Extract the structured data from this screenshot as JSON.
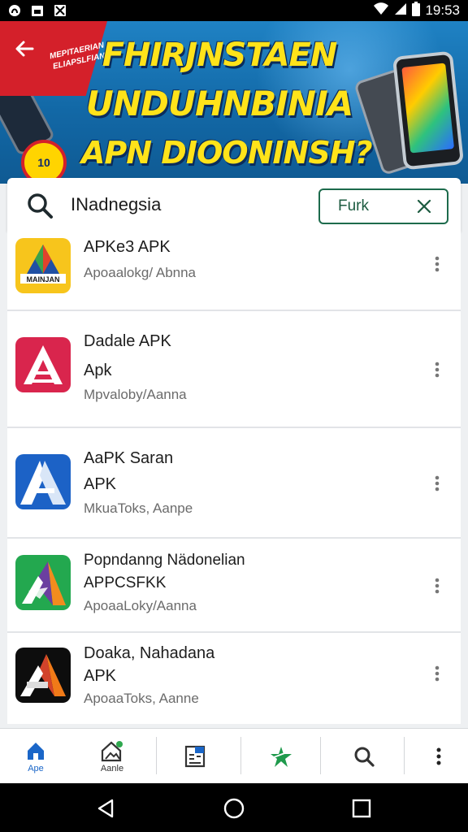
{
  "status_bar": {
    "time": "19:53",
    "left_icons": [
      "app-notification-icon",
      "calendar-icon",
      "gallery-icon"
    ],
    "right_icons": [
      "wifi-icon",
      "cellular-signal-icon",
      "battery-icon"
    ]
  },
  "banner": {
    "headline_line1": "FHIRJNSTAEN",
    "headline_line2": "UNDUHNBINIA",
    "headline_line3": "APN DIOONINSH?",
    "promo_text": "MEPITAERIAN ELIAPSLFIAN",
    "badge_text": "10",
    "back_icon": "arrow-back-icon"
  },
  "search": {
    "query": "INadnegsia",
    "filter_chip_label": "Furk",
    "chip_close_icon": "close-icon"
  },
  "apps": [
    {
      "title": "APKe3 APK",
      "subtitle": "",
      "meta": "Apoaalokg/ Abnna",
      "icon_label": "MAINJAN",
      "icon_style": "yellow"
    },
    {
      "title": "Dadale APK",
      "subtitle": "Apk",
      "meta": "Mpvaloby/Aanna",
      "icon_style": "red"
    },
    {
      "title": "AaPK Saran",
      "subtitle": "APK",
      "meta": "MkuaToks, Aanpe",
      "icon_style": "blue"
    },
    {
      "title": "Popndanng Nädonelian",
      "subtitle": "APPCSFKK",
      "meta": "ApoaaLoky/Aanna",
      "icon_style": "green"
    },
    {
      "title": "Doaka, Nahadana",
      "subtitle": "APK",
      "meta": "ApoaaToks, Aanne",
      "icon_style": "black"
    }
  ],
  "bottom_nav": {
    "items": [
      {
        "label": "Ape",
        "icon": "home-icon",
        "active": true
      },
      {
        "label": "Aanle",
        "icon": "image-icon",
        "active": false
      },
      {
        "label": "",
        "icon": "apps-grid-icon",
        "active": false
      },
      {
        "label": "",
        "icon": "star-icon",
        "active": false
      },
      {
        "label": "",
        "icon": "search-icon",
        "active": false
      },
      {
        "label": "",
        "icon": "more-vert-icon",
        "active": false
      }
    ]
  },
  "system_nav": {
    "buttons": [
      "back-icon",
      "home-circle-icon",
      "recents-icon"
    ]
  },
  "colors": {
    "accent": "#1a66c8",
    "chip_border": "#1d6b4c",
    "star_green": "#1f9a4c",
    "banner_blue": "#1268a6",
    "headline_yellow": "#ffe31a",
    "ribbon_red": "#d4202a"
  }
}
